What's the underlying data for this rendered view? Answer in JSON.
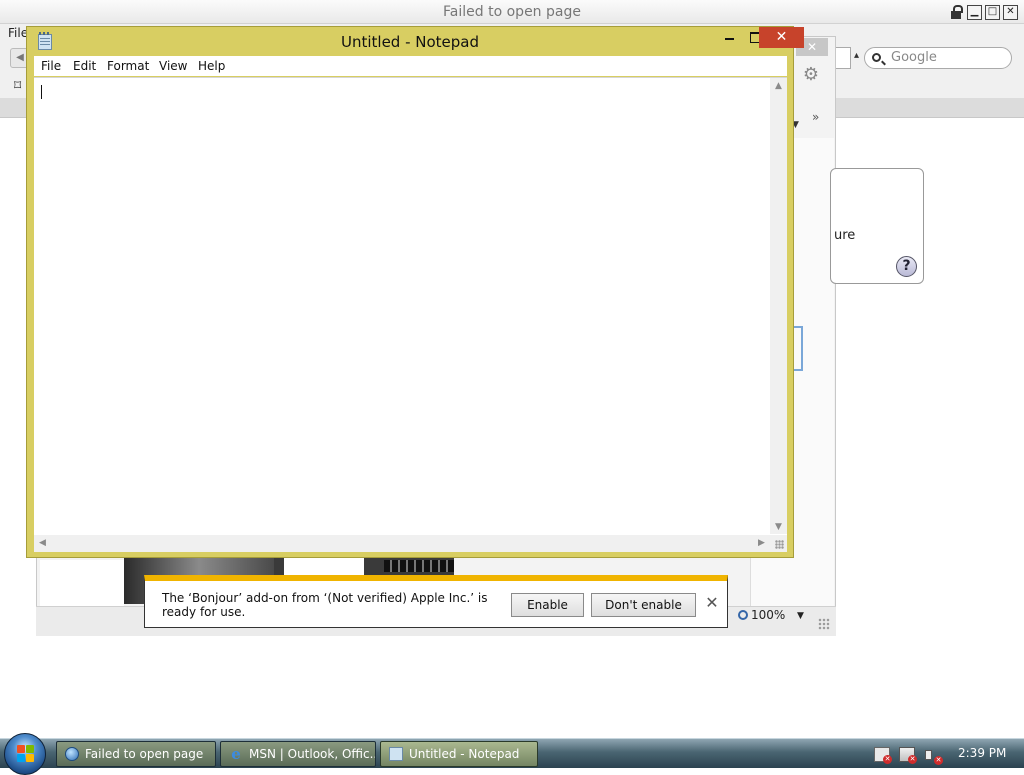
{
  "browser": {
    "title": "Failed to open page",
    "menu_file": "File",
    "search_placeholder": "Google",
    "zoom": "100%",
    "side_text": "ure",
    "help": "?"
  },
  "notepad": {
    "title": "Untitled - Notepad",
    "menu": [
      "File",
      "Edit",
      "Format",
      "View",
      "Help"
    ],
    "content": "",
    "close_label": "✕"
  },
  "notification": {
    "message": "The ‘Bonjour’ add-on from ‘(Not verified) Apple Inc.’ is ready for use.",
    "enable_label": "Enable",
    "dont_enable_label": "Don't enable",
    "close_label": "✕"
  },
  "taskbar": {
    "items": [
      {
        "label": "Failed to open page",
        "icon": "globe-icon"
      },
      {
        "label": "MSN | Outlook, Offic...",
        "icon": "ie-icon"
      },
      {
        "label": "Untitled - Notepad",
        "icon": "notepad-icon",
        "active": true
      }
    ],
    "clock": "2:39 PM"
  },
  "colors": {
    "notepad_frame": "#d8ce62",
    "close_red": "#c7432b",
    "notification_accent": "#f0b400"
  }
}
